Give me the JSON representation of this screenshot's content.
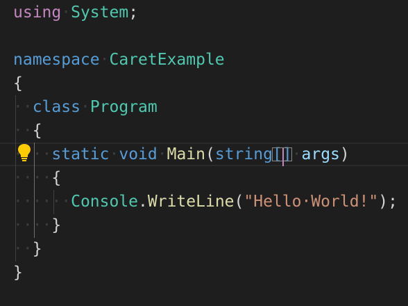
{
  "editor": {
    "lines": [
      {
        "parts": [
          [
            "kw",
            "using"
          ],
          [
            "ws",
            "·"
          ],
          [
            "type",
            "System"
          ],
          [
            "plain",
            ";"
          ]
        ]
      },
      {
        "parts": []
      },
      {
        "parts": [
          [
            "kw2",
            "namespace"
          ],
          [
            "ws",
            "·"
          ],
          [
            "type",
            "CaretExample"
          ]
        ]
      },
      {
        "parts": [
          [
            "plain",
            "{"
          ]
        ]
      },
      {
        "parts": [
          [
            "ws",
            "··"
          ],
          [
            "kw2",
            "class"
          ],
          [
            "ws",
            "·"
          ],
          [
            "type",
            "Program"
          ]
        ]
      },
      {
        "parts": [
          [
            "ws",
            "··"
          ],
          [
            "plain",
            "{"
          ]
        ]
      },
      {
        "parts": [
          [
            "ws",
            "····"
          ],
          [
            "kw2",
            "static"
          ],
          [
            "ws",
            "·"
          ],
          [
            "kw2",
            "void"
          ],
          [
            "ws",
            "·"
          ],
          [
            "fn",
            "Main"
          ],
          [
            "plain",
            "("
          ],
          [
            "kw2",
            "string"
          ],
          [
            "bracket",
            "[]"
          ],
          [
            "ws",
            "·"
          ],
          [
            "ident",
            "args"
          ],
          [
            "plain",
            ")"
          ]
        ]
      },
      {
        "parts": [
          [
            "ws",
            "····"
          ],
          [
            "plain",
            "{"
          ]
        ]
      },
      {
        "parts": [
          [
            "ws",
            "······"
          ],
          [
            "type",
            "Console"
          ],
          [
            "plain",
            "."
          ],
          [
            "fn",
            "WriteLine"
          ],
          [
            "plain",
            "("
          ],
          [
            "str",
            "\"Hello·World!\""
          ],
          [
            "plain",
            ");"
          ]
        ]
      },
      {
        "parts": [
          [
            "ws",
            "····"
          ],
          [
            "plain",
            "}"
          ]
        ]
      },
      {
        "parts": [
          [
            "ws",
            "··"
          ],
          [
            "plain",
            "}"
          ]
        ]
      },
      {
        "parts": [
          [
            "plain",
            "}"
          ]
        ]
      }
    ],
    "lightbulb_icon": "lightbulb-icon",
    "colors": {
      "background": "#1e1e1e",
      "keyword_control": "#c586c0",
      "keyword": "#569cd6",
      "type": "#4ec9b0",
      "function": "#dcdcaa",
      "string": "#ce9178",
      "identifier": "#9cdcfe",
      "cursor": "#c586c0"
    }
  }
}
